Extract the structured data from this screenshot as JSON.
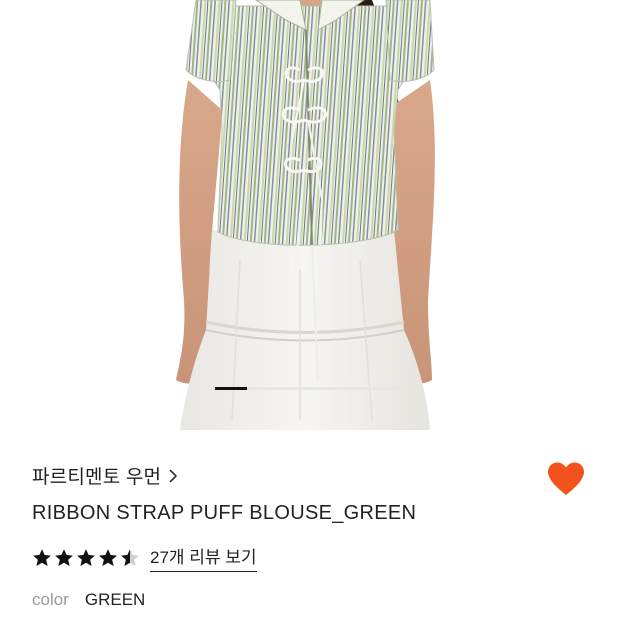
{
  "product": {
    "image_alt": "Model wearing green striped puff-sleeve blouse with ribbon ties and white tiered skirt",
    "brand": "파르티멘토 우먼",
    "title": "RIBBON STRAP PUFF BLOUSE_GREEN",
    "rating": 4.5,
    "rating_max": 5,
    "review_link_label": "27개 리뷰 보기",
    "option_label": "color",
    "option_value": "GREEN",
    "liked": true
  },
  "carousel": {
    "total_slides": 6,
    "active_index": 0
  },
  "colors": {
    "heart": "#f2521b",
    "text": "#222222",
    "muted": "#9a9a9a",
    "star": "#111111"
  },
  "icons": {
    "brand_chevron": "chevron-right-icon",
    "like": "heart-icon",
    "star": "star-icon"
  }
}
